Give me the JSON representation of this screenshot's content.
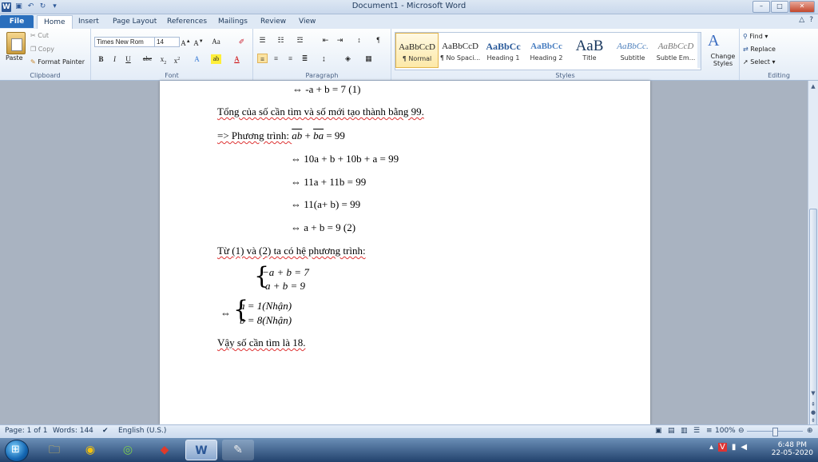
{
  "window": {
    "title": "Document1 - Microsoft Word",
    "buttons": {
      "minimize": "–",
      "maximize": "□",
      "close": "✕"
    }
  },
  "tabs": [
    "File",
    "Home",
    "Insert",
    "Page Layout",
    "References",
    "Mailings",
    "Review",
    "View"
  ],
  "active_tab": "Home",
  "ribbon": {
    "clipboard": {
      "paste": "Paste",
      "cut": "Cut",
      "copy": "Copy",
      "format_painter": "Format Painter",
      "label": "Clipboard"
    },
    "font": {
      "name": "Times New Rom",
      "size": "14",
      "label": "Font"
    },
    "paragraph": {
      "label": "Paragraph"
    },
    "styles": {
      "label": "Styles",
      "items": [
        {
          "sample": "AaBbCcD",
          "name": "¶ Normal"
        },
        {
          "sample": "AaBbCcD",
          "name": "¶ No Spaci..."
        },
        {
          "sample": "AaBbCc",
          "name": "Heading 1"
        },
        {
          "sample": "AaBbCc",
          "name": "Heading 2"
        },
        {
          "sample": "AaB",
          "name": "Title"
        },
        {
          "sample": "AaBbCc.",
          "name": "Subtitle"
        },
        {
          "sample": "AaBbCcD",
          "name": "Subtle Em..."
        }
      ],
      "change_styles": "Change Styles"
    },
    "editing": {
      "find": "Find",
      "replace": "Replace",
      "select": "Select",
      "label": "Editing"
    }
  },
  "doc": {
    "line1": "⇔  -a + b = 7 (1)",
    "sentence1": "Tổng của số cần tìm và số mới tạo thành bằng  99.",
    "eq_prefix": "=> Phương trình: ",
    "eq_ab": "ab",
    "eq_plus": " + ",
    "eq_ba": "ba",
    "eq_rhs": " = 99",
    "step1": "⇔  10a + b + 10b + a = 99",
    "step2": "⇔  11a + 11b = 99",
    "step3": "⇔  11(a+ b) = 99",
    "step4": "⇔  a + b = 9 (2)",
    "sentence2": "Từ (1) và (2) ta có hệ phương trình:",
    "sys1_row1": "−a + b = 7",
    "sys1_row2": "a + b = 9",
    "sys2_arrow": "⇔",
    "sys2_row1": "a = 1(Nhận)",
    "sys2_row2": "b = 8(Nhận)",
    "conclusion": "Vậy số cần tìm là 18."
  },
  "status": {
    "page": "Page: 1 of 1",
    "words": "Words: 144",
    "lang": "English (U.S.)",
    "zoom": "100%"
  },
  "taskbar": {
    "time": "6:48 PM",
    "date": "22-05-2020"
  }
}
